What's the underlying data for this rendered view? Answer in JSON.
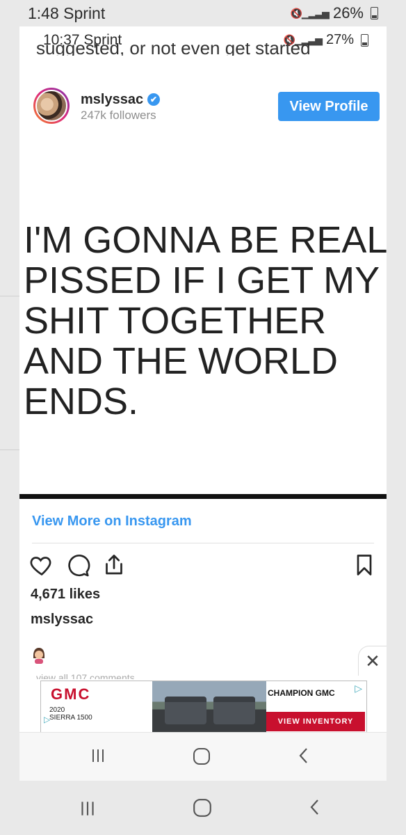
{
  "outer_status": {
    "time": "1:48 Sprint",
    "battery": "26%",
    "signal": "LTE"
  },
  "inner_status": {
    "time": "10:37 Sprint",
    "battery": "27%",
    "signal": "LTE"
  },
  "cutoff_text": "suggested, or not even get started",
  "post": {
    "username": "mslyssac",
    "followers": "247k followers",
    "view_profile_label": "View Profile",
    "quote_lines": [
      "I'M GONNA BE REAL",
      "PISSED IF I GET MY",
      "SHIT TOGETHER",
      "AND THE WORLD",
      "ENDS."
    ],
    "view_more_label": "View More on Instagram",
    "likes": "4,671 likes",
    "owner": "mslyssac",
    "comments_cutoff": "view all 107 comments"
  },
  "ad": {
    "brand": "GMC",
    "model": "2020\nSIERRA 1500",
    "dealer": "CHAMPION GMC",
    "cta": "VIEW INVENTORY",
    "close_label": "✕"
  },
  "icons": {
    "like": "heart-icon",
    "comment": "comment-icon",
    "share": "share-icon",
    "save": "bookmark-icon",
    "recents": "recent-apps-icon",
    "home": "home-icon",
    "back": "back-icon"
  },
  "colors": {
    "accent": "#3897f0",
    "gmc_red": "#c8102e"
  }
}
